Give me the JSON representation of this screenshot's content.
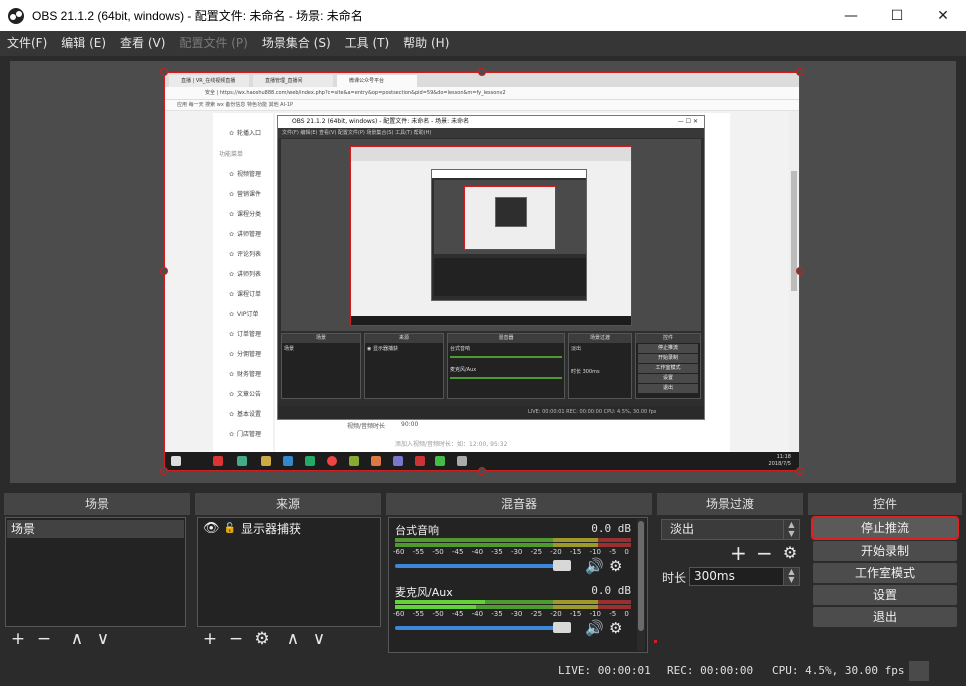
{
  "window": {
    "title": "OBS 21.1.2 (64bit, windows) - 配置文件: 未命名 - 场景: 未命名",
    "controls": [
      "—",
      "☐",
      "✕"
    ]
  },
  "menu": [
    {
      "label": "文件(F)",
      "disabled": false
    },
    {
      "label": "编辑 (E)",
      "disabled": false
    },
    {
      "label": "查看 (V)",
      "disabled": false
    },
    {
      "label": "配置文件 (P)",
      "disabled": true
    },
    {
      "label": "场景集合 (S)",
      "disabled": false
    },
    {
      "label": "工具 (T)",
      "disabled": false
    },
    {
      "label": "帮助 (H)",
      "disabled": false
    }
  ],
  "capture": {
    "tabs": [
      "直播 | VR_在线视频直播",
      "直播管理_直播间",
      "微课公众号平台"
    ],
    "address": "安全 | https://wx.haoshu888.com/web/index.php?c=site&a=entry&op=postsection&pid=59&do=lesson&m=fy_lessonv2",
    "bookmarks": "应用  每一天  搜索  wx  备份信息  特色功能  其他  AI-1P",
    "side_group": "功能菜单",
    "side_items": [
      "轮播入口",
      "视频管理",
      "营销课件",
      "课程分类",
      "讲师管理",
      "评论列表",
      "讲师列表",
      "课程订单",
      "VIP订单",
      "订单管理",
      "分佣管理",
      "财务管理",
      "文章公告",
      "基本设置",
      "门店管理"
    ],
    "footer_label": "视频/音频时长",
    "footer_value": "90:00",
    "footer_note": "添加入视频/音频时长：如：12:00, 95:32",
    "clock_time": "11:18",
    "clock_date": "2018/7/5",
    "nested_title": "OBS 21.1.2 (64bit, windows) - 配置文件: 未命名 - 场景: 未命名",
    "nested_menu": "文件(F)  编辑(E)  查看(V)  配置文件(P)  场景集合(S)  工具(T)  帮助(H)",
    "nested_panels": [
      "场景",
      "来源",
      "混音器",
      "场景过渡",
      "控件"
    ],
    "nested_scene": "场景",
    "nested_source": "◉ 显示器捕获",
    "nested_mixer_1": "台式音响",
    "nested_mixer_2": "麦克风/Aux",
    "nested_transition": "淡出",
    "nested_duration": "时长  300ms",
    "nested_buttons": [
      "停止推流",
      "开始录制",
      "工作室模式",
      "设置",
      "退出"
    ],
    "nested_status": "LIVE: 00:00:01    REC: 00:00:00    CPU: 4.5%, 30.00 fps"
  },
  "docks": {
    "scenes": {
      "title": "场景",
      "items": [
        "场景"
      ]
    },
    "sources": {
      "title": "来源",
      "items": [
        "显示器捕获"
      ]
    },
    "mixer": {
      "title": "混音器",
      "ticks": [
        "-60",
        "-55",
        "-50",
        "-45",
        "-40",
        "-35",
        "-30",
        "-25",
        "-20",
        "-15",
        "-10",
        "-5",
        "0"
      ],
      "channels": [
        {
          "name": "台式音响",
          "db": "0.0 dB",
          "level": 0.0,
          "volume": 1.0
        },
        {
          "name": "麦克风/Aux",
          "db": "0.0 dB",
          "level": 0.38,
          "volume": 1.0
        }
      ]
    },
    "transitions": {
      "title": "场景过渡",
      "selected": "淡出",
      "duration_label": "时长",
      "duration_value": "300ms"
    },
    "controls": {
      "title": "控件",
      "buttons": [
        "停止推流",
        "开始录制",
        "工作室模式",
        "设置",
        "退出"
      ]
    }
  },
  "status": {
    "live": "LIVE: 00:00:01",
    "rec": "REC: 00:00:00",
    "cpu": "CPU: 4.5%, 30.00 fps"
  },
  "colors": {
    "accent_red": "#d01d1d",
    "meter_green": "#4f9a2f",
    "meter_yellow": "#9d9a2b",
    "meter_red": "#9a2f2f",
    "slider_blue": "#3d86d8"
  },
  "icons": {
    "add": "plus-icon",
    "remove": "minus-icon",
    "up": "chevron-up-icon",
    "down": "chevron-down-icon",
    "settings": "gear-icon",
    "visible": "eye-icon",
    "lock": "lock-icon",
    "speaker": "speaker-icon"
  }
}
